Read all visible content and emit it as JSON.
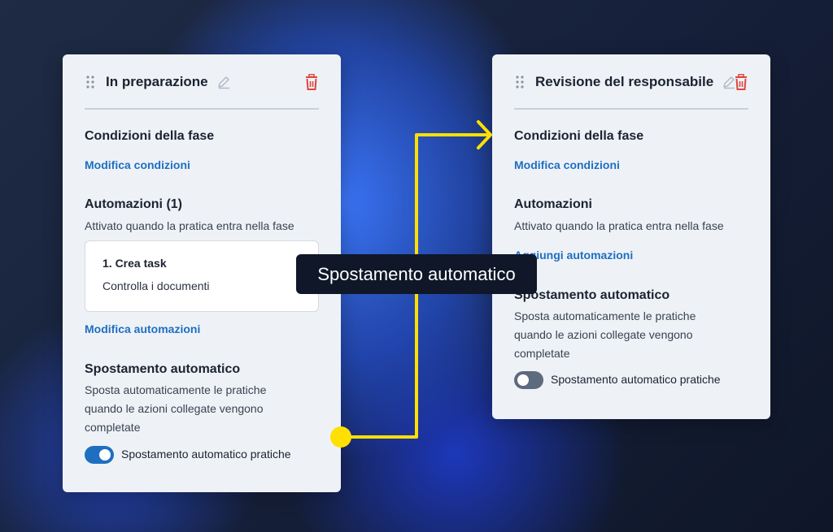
{
  "colors": {
    "accent": "#1f6fc0",
    "connector": "#ffe000",
    "danger": "#e0453b"
  },
  "left_card": {
    "title": "In preparazione",
    "conditions_title": "Condizioni della fase",
    "conditions_link": "Modifica condizioni",
    "automations_title": "Automazioni (1)",
    "automations_desc": "Attivato quando la pratica entra nella fase",
    "task": {
      "title": "1. Crea task",
      "description": "Controlla i documenti"
    },
    "automations_link": "Modifica automazioni",
    "auto_move_title": "Spostamento automatico",
    "auto_move_desc": [
      "Sposta automaticamente le pratiche",
      "quando le azioni collegate vengono",
      "completate"
    ],
    "toggle_label": "Spostamento automatico pratiche",
    "toggle_on": true
  },
  "right_card": {
    "title": "Revisione del responsabile",
    "conditions_title": "Condizioni della fase",
    "conditions_link": "Modifica condizioni",
    "automations_title": "Automazioni",
    "automations_desc": "Attivato quando la pratica entra nella fase",
    "automations_link": "Aggiungi automazioni",
    "auto_move_title": "Spostamento automatico",
    "auto_move_desc": [
      "Sposta automaticamente le pratiche",
      "quando le azioni collegate vengono",
      "completate"
    ],
    "toggle_label": "Spostamento automatico pratiche",
    "toggle_on": false
  },
  "tooltip": "Spostamento automatico",
  "icons": [
    "drag-handle-icon",
    "pencil-icon",
    "trash-icon",
    "arrow-icon"
  ]
}
